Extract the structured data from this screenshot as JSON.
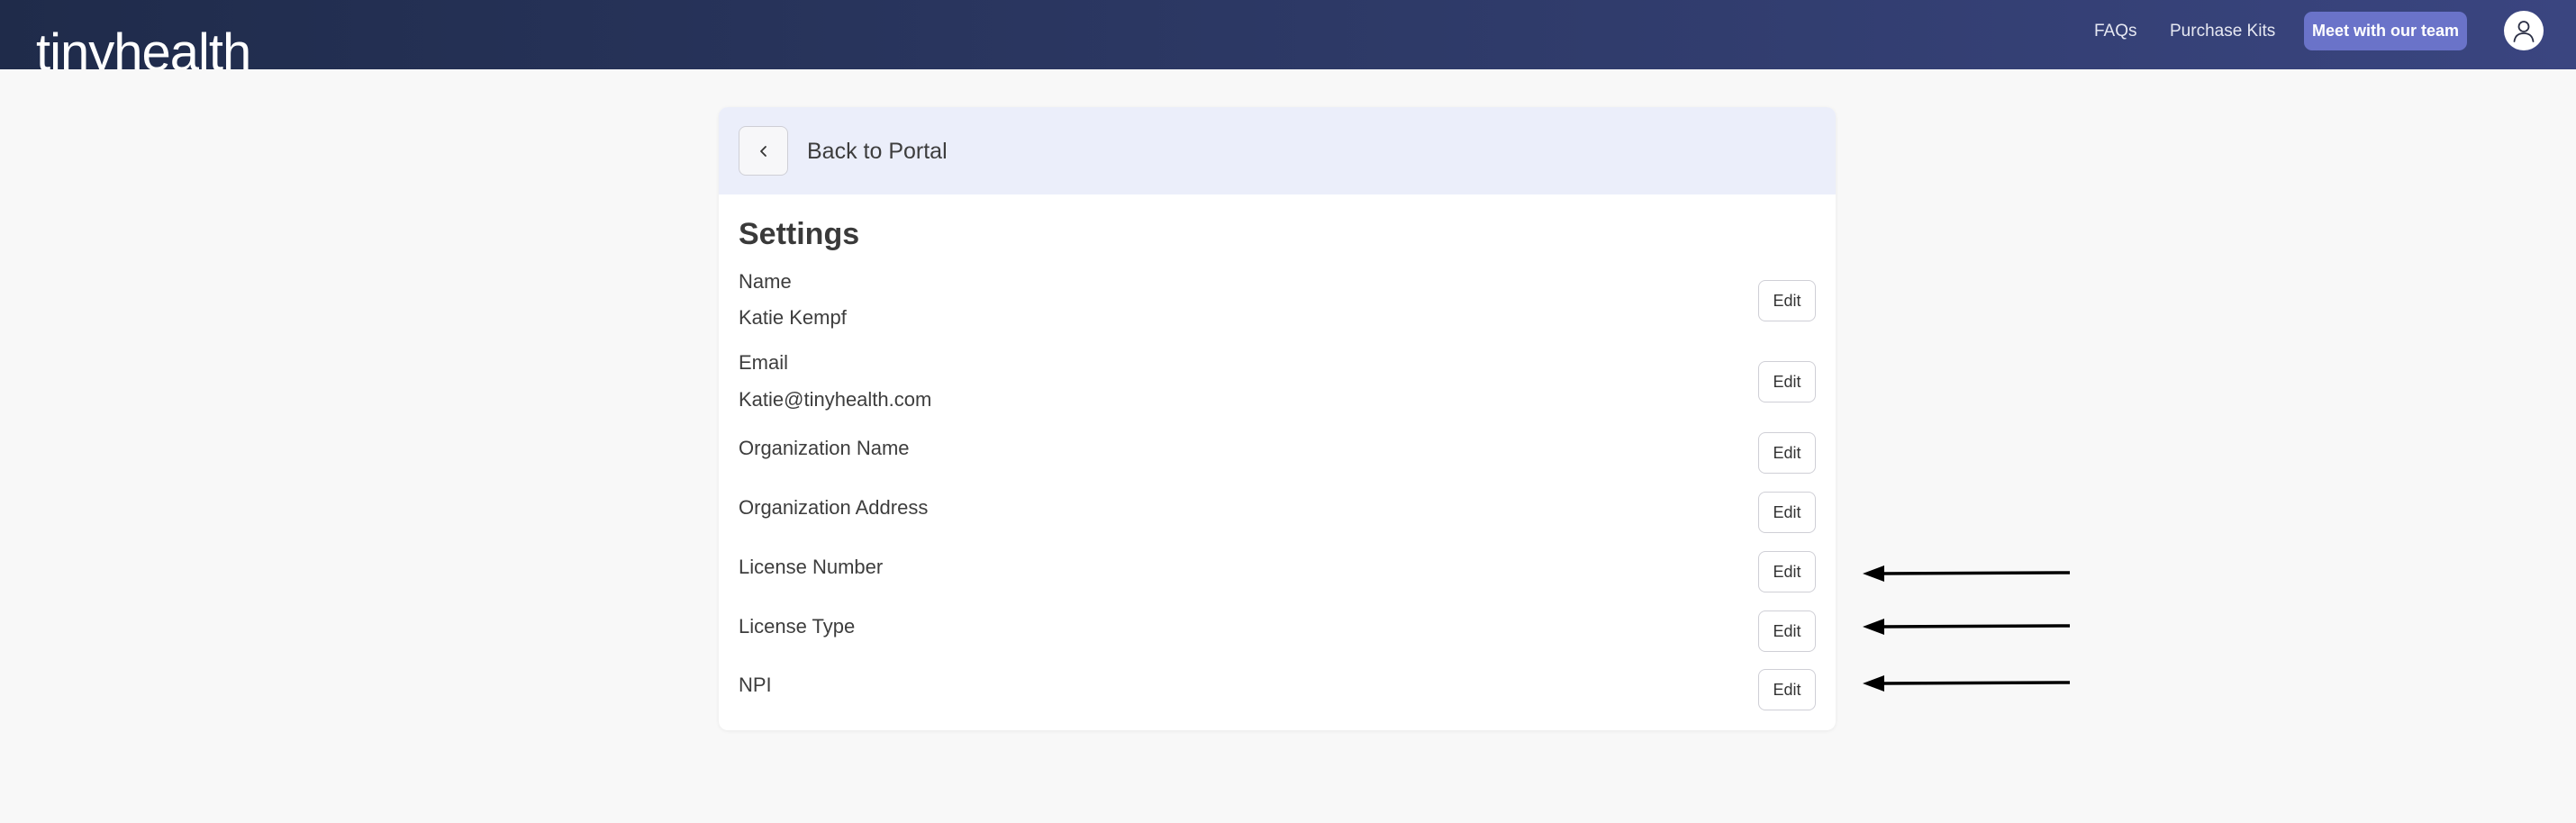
{
  "header": {
    "logo": "tinyhealth",
    "nav": {
      "faqs": "FAQs",
      "purchase_kits": "Purchase Kits"
    },
    "cta_label": "Meet with our team",
    "avatar_icon": "user-icon"
  },
  "card": {
    "back_label": "Back to Portal",
    "back_icon": "chevron-left-icon",
    "title": "Settings",
    "fields": [
      {
        "label": "Name",
        "value": "Katie Kempf",
        "edit": "Edit"
      },
      {
        "label": "Email",
        "value": "Katie@tinyhealth.com",
        "edit": "Edit"
      },
      {
        "label": "Organization Name",
        "value": "",
        "edit": "Edit"
      },
      {
        "label": "Organization Address",
        "value": "",
        "edit": "Edit"
      },
      {
        "label": "License Number",
        "value": "",
        "edit": "Edit"
      },
      {
        "label": "License Type",
        "value": "",
        "edit": "Edit"
      },
      {
        "label": "NPI",
        "value": "",
        "edit": "Edit"
      }
    ]
  },
  "annotations": {
    "arrow_icon": "left-arrow-icon",
    "arrow_color": "#000000"
  },
  "colors": {
    "header_gradient_start": "#1f2b4a",
    "header_gradient_end": "#3a4580",
    "cta": "#6a73c9",
    "card_header_bg": "#ebeefa",
    "page_bg": "#f8f8f8"
  }
}
